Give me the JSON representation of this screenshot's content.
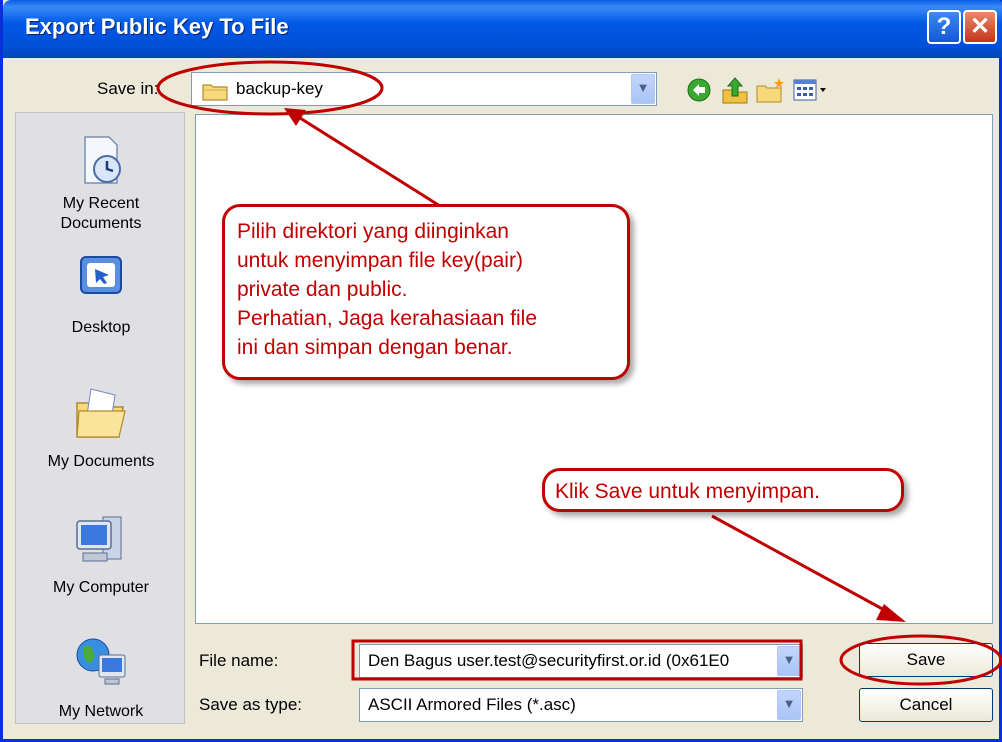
{
  "window": {
    "title": "Export Public Key To File",
    "help_glyph": "?",
    "close_glyph": "✕"
  },
  "toolbar": {
    "save_in_label": "Save in:",
    "current_folder": "backup-key",
    "icons": [
      "back-icon",
      "up-folder-icon",
      "new-folder-icon",
      "views-menu-icon"
    ]
  },
  "places": [
    {
      "label_lines": [
        "My Recent",
        "Documents"
      ],
      "icon": "recent-documents-icon"
    },
    {
      "label_lines": [
        "Desktop"
      ],
      "icon": "desktop-icon"
    },
    {
      "label_lines": [
        "My Documents"
      ],
      "icon": "my-documents-icon"
    },
    {
      "label_lines": [
        "My Computer"
      ],
      "icon": "my-computer-icon"
    },
    {
      "label_lines": [
        "My Network"
      ],
      "icon": "my-network-icon"
    }
  ],
  "form": {
    "filename_label": "File name:",
    "filename_value": "Den Bagus user.test@securityfirst.or.id (0x61E0",
    "filetype_label": "Save as type:",
    "filetype_value": "ASCII Armored Files (*.asc)"
  },
  "buttons": {
    "save": "Save",
    "cancel": "Cancel"
  },
  "annotations": {
    "callout1_lines": [
      "Pilih direktori yang diinginkan",
      "untuk menyimpan file key(pair)",
      "private dan public.",
      "Perhatian, Jaga  kerahasiaan file",
      "ini dan simpan dengan benar."
    ],
    "callout2": "Klik Save untuk menyimpan."
  },
  "colors": {
    "annotation": "#c00000",
    "titlebar": "#0058e6"
  }
}
